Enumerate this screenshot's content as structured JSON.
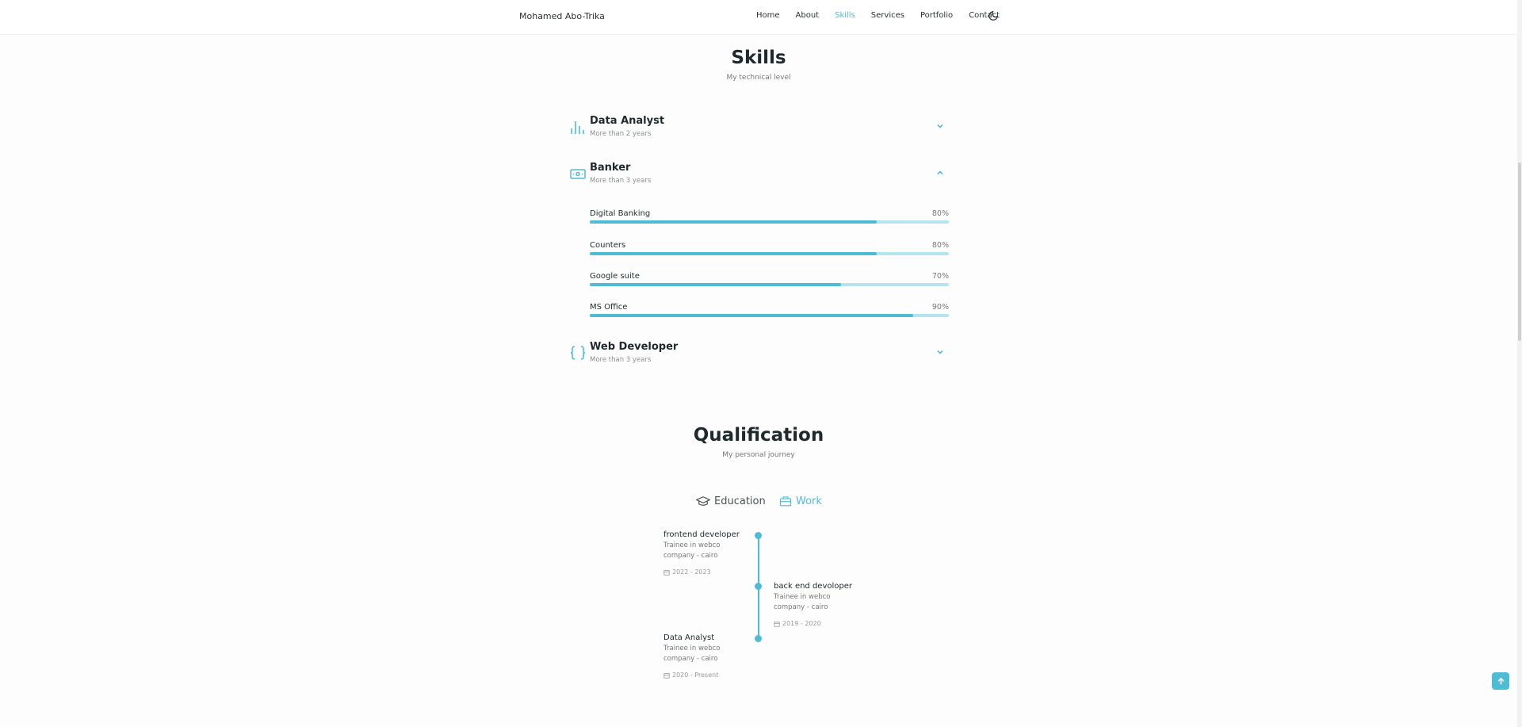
{
  "header": {
    "logo": "Mohamed Abo-Trika",
    "nav": [
      "Home",
      "About",
      "Skills",
      "Services",
      "Portfolio",
      "Contact"
    ],
    "active_nav": "Skills",
    "theme_icon": "moon-icon"
  },
  "skills": {
    "title": "Skills",
    "subtitle": "My technical level",
    "categories": [
      {
        "title": "Data Analyst",
        "subtitle": "More than 2 years",
        "icon": "bar-chart-icon",
        "expanded": false
      },
      {
        "title": "Banker",
        "subtitle": "More than 3 years",
        "icon": "money-icon",
        "expanded": true,
        "items": [
          {
            "name": "Digital Banking",
            "percent_label": "80%",
            "percent": 80
          },
          {
            "name": "Counters",
            "percent_label": "80%",
            "percent": 80
          },
          {
            "name": "Google suite",
            "percent_label": "70%",
            "percent": 70
          },
          {
            "name": "MS Office",
            "percent_label": "90%",
            "percent": 90
          }
        ]
      },
      {
        "title": "Web Developer",
        "subtitle": "More than 3 years",
        "icon": "braces-icon",
        "expanded": false
      }
    ]
  },
  "qualification": {
    "title": "Qualification",
    "subtitle": "My personal journey",
    "tabs": [
      {
        "label": "Education",
        "icon": "graduation-cap-icon",
        "active": false
      },
      {
        "label": "Work",
        "icon": "briefcase-icon",
        "active": true
      }
    ],
    "timeline": [
      {
        "title": "frontend developer",
        "subtitle_line1": "Trainee in webco",
        "subtitle_line2": "company - cairo",
        "date": "2022 - 2023",
        "side": "left"
      },
      {
        "title": "back end devoloper",
        "subtitle_line1": "Trainee in webco",
        "subtitle_line2": "company - cairo",
        "date": "2019 - 2020",
        "side": "right"
      },
      {
        "title": "Data Analyst",
        "subtitle_line1": "Trainee in webco",
        "subtitle_line2": "company - cairo",
        "date": "2020 - Present",
        "side": "left"
      }
    ]
  },
  "colors": {
    "accent": "#4fbcd6",
    "accent_light": "#b4e5ef",
    "text": "#1f2a2c"
  }
}
